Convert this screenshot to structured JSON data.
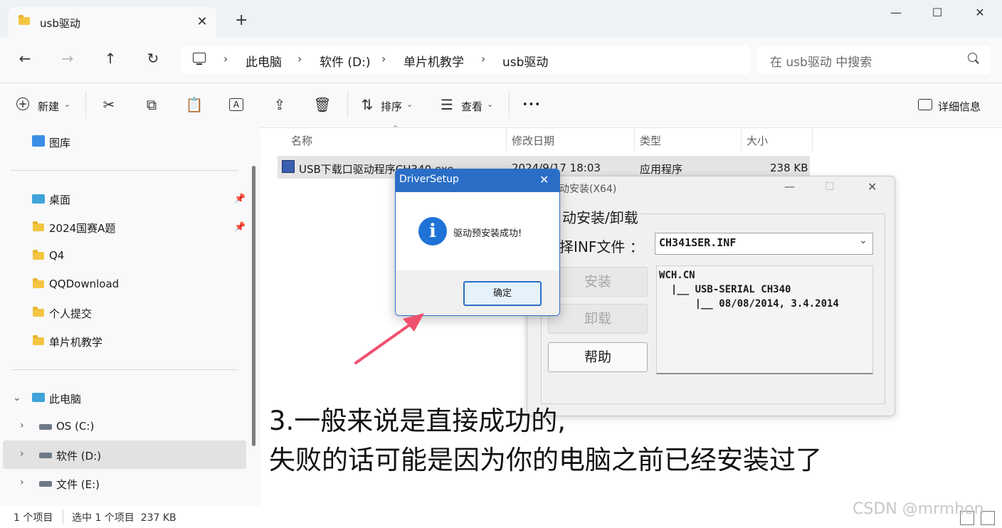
{
  "window": {
    "tab_title": "usb驱动",
    "new_tab": "+",
    "minimize": "—",
    "maximize": "☐",
    "close": "✕"
  },
  "nav": {
    "back": "←",
    "forward": "→",
    "up": "↑",
    "refresh": "↻",
    "breadcrumb": [
      "此电脑",
      "软件 (D:)",
      "单片机教学",
      "usb驱动"
    ],
    "breadcrumb_sep": "›",
    "search_placeholder": "在 usb驱动 中搜索"
  },
  "toolbar": {
    "new_label": "新建",
    "sort_label": "排序",
    "view_label": "查看",
    "more": "•••",
    "details_label": "详细信息",
    "dropdown_caret": "⌄"
  },
  "sidebar": {
    "gallery": "图库",
    "quick_access": [
      {
        "label": "桌面",
        "pinned": true
      },
      {
        "label": "2024国赛A题",
        "pinned": true
      },
      {
        "label": "Q4",
        "pinned": false
      },
      {
        "label": "QQDownload",
        "pinned": false
      },
      {
        "label": "个人提交",
        "pinned": false
      },
      {
        "label": "单片机教学",
        "pinned": false
      }
    ],
    "this_pc": "此电脑",
    "drives": [
      "OS (C:)",
      "软件 (D:)",
      "文件 (E:)"
    ]
  },
  "file_list": {
    "columns": [
      "名称",
      "修改日期",
      "类型",
      "大小"
    ],
    "rows": [
      {
        "name": "USB下载口驱动程序CH340.exe",
        "modified": "2024/9/17 18:03",
        "type": "应用程序",
        "size": "238 KB"
      }
    ]
  },
  "status_bar": {
    "count": "1 个项目",
    "selection": "选中 1 个项目  237 KB"
  },
  "install_dialog": {
    "title": "动安装(X64)",
    "group_label": "动安装/卸载",
    "inf_label": "择INF文件 ：",
    "inf_value": "CH341SER.INF",
    "install_button": "安装",
    "uninstall_button": "卸载",
    "help_button": "帮助",
    "info_lines": [
      "WCH.CN",
      "  |__ USB-SERIAL CH340",
      "      |__ 08/08/2014, 3.4.2014"
    ]
  },
  "message_dialog": {
    "title": "DriverSetup",
    "message": "驱动预安装成功!",
    "ok_button": "确定",
    "info_icon": "i"
  },
  "annotation": {
    "line1": "3.一般来说是直接成功的,",
    "line2": "失败的话可能是因为你的电脑之前已经安装过了",
    "arrow_color": "#f0506e"
  },
  "watermark": "CSDN @mrmhon"
}
